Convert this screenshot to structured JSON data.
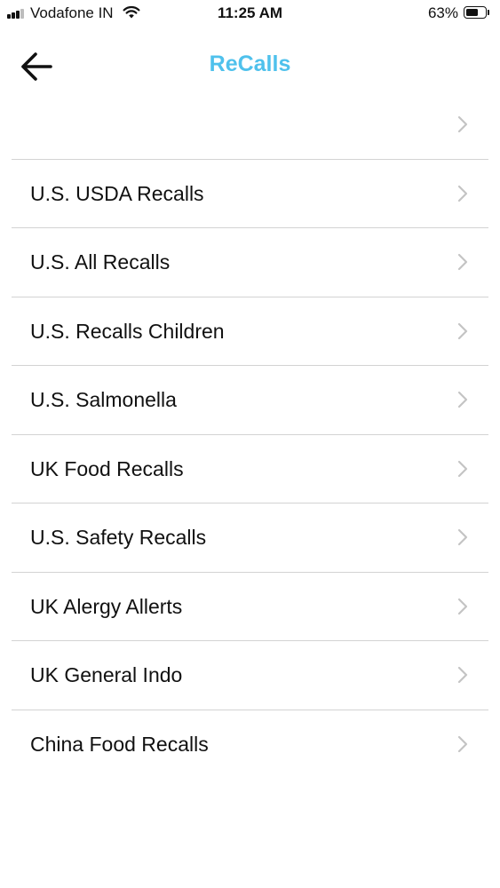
{
  "status_bar": {
    "carrier": "Vodafone IN",
    "time": "11:25 AM",
    "battery_percent": "63%",
    "battery_level": 0.63,
    "signal_bars_filled": 3,
    "signal_bars_total": 4,
    "icons": [
      "signal-icon",
      "wifi-icon",
      "battery-icon"
    ]
  },
  "nav": {
    "title": "ReCalls",
    "title_color": "#4fc1ec",
    "back_icon": "back-arrow-icon"
  },
  "list": {
    "items": [
      {
        "label": ""
      },
      {
        "label": "U.S. USDA Recalls"
      },
      {
        "label": "U.S. All Recalls"
      },
      {
        "label": "U.S. Recalls Children"
      },
      {
        "label": "U.S. Salmonella"
      },
      {
        "label": "UK Food Recalls"
      },
      {
        "label": "U.S. Safety Recalls"
      },
      {
        "label": "UK Alergy Allerts"
      },
      {
        "label": "UK General Indo"
      },
      {
        "label": "China Food Recalls"
      }
    ],
    "chevron_icon": "chevron-right-icon",
    "divider_color": "#d3d3d3"
  }
}
